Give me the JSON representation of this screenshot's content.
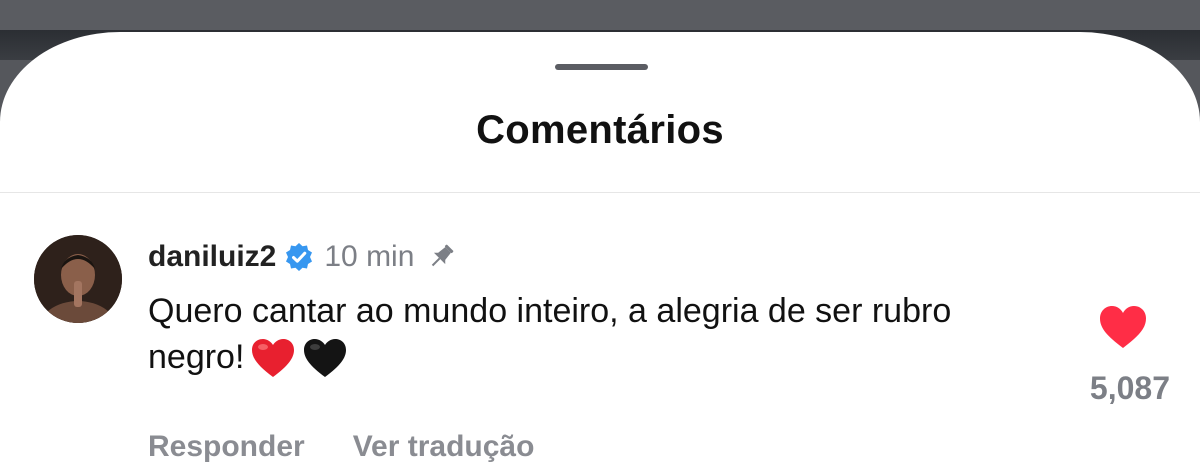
{
  "sheet": {
    "title": "Comentários"
  },
  "comment": {
    "username": "daniluiz2",
    "verified": true,
    "time": "10 min",
    "pinned": true,
    "text": "Quero cantar ao mundo inteiro, a alegria de ser rubro negro!",
    "emojis": [
      "red-heart",
      "black-heart"
    ],
    "likes": "5,087",
    "liked": true,
    "actions": {
      "reply": "Responder",
      "translate": "Ver tradução"
    }
  },
  "colors": {
    "like_red": "#ff2d46",
    "verified_blue": "#3797f0",
    "secondary_text": "#7c7f86"
  }
}
